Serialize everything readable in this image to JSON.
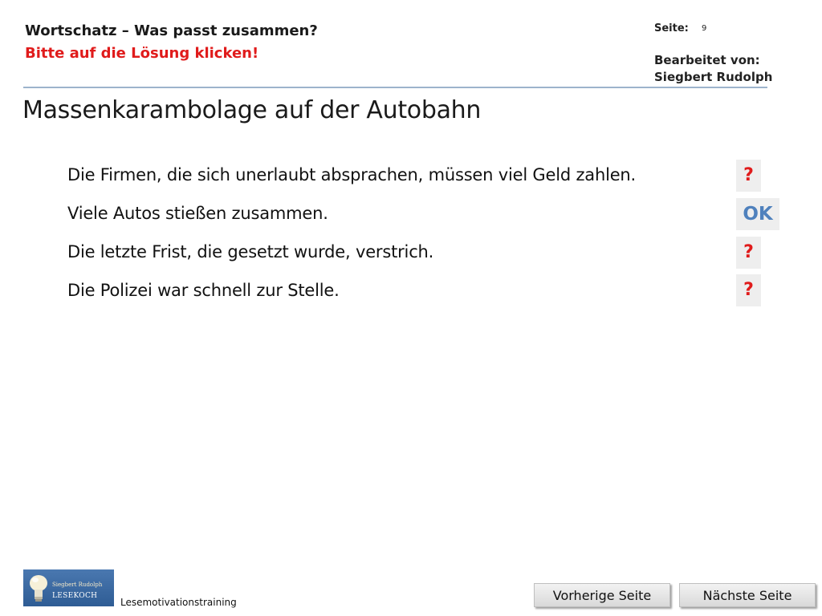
{
  "header": {
    "title": "Wortschatz – Was passt zusammen?",
    "subtitle": "Bitte auf die Lösung klicken!",
    "page_label": "Seite:",
    "page_number": "9",
    "edited_by_label": "Bearbeitet  von:",
    "edited_by_name": "Siegbert  Rudolph"
  },
  "main": {
    "title": "Massenkarambolage auf der Autobahn",
    "sentences": [
      {
        "text": "Die Firmen, die sich unerlaubt absprachen, müssen viel Geld zahlen.",
        "answer": "?"
      },
      {
        "text": "Viele Autos stießen zusammen.",
        "answer": "OK"
      },
      {
        "text": "Die letzte Frist, die gesetzt wurde, verstrich.",
        "answer": "?"
      },
      {
        "text": "Die Polizei war schnell zur Stelle.",
        "answer": "?"
      }
    ]
  },
  "footer": {
    "logo_author": "Siegbert Rudolph",
    "logo_text": "LESEKOCH",
    "label": "Lesemotivationstraining",
    "prev_button": "Vorherige Seite",
    "next_button": "Nächste Seite"
  },
  "colors": {
    "accent_red": "#e01b1b",
    "ok_blue": "#4f81bd",
    "rule": "#9db3cc"
  }
}
